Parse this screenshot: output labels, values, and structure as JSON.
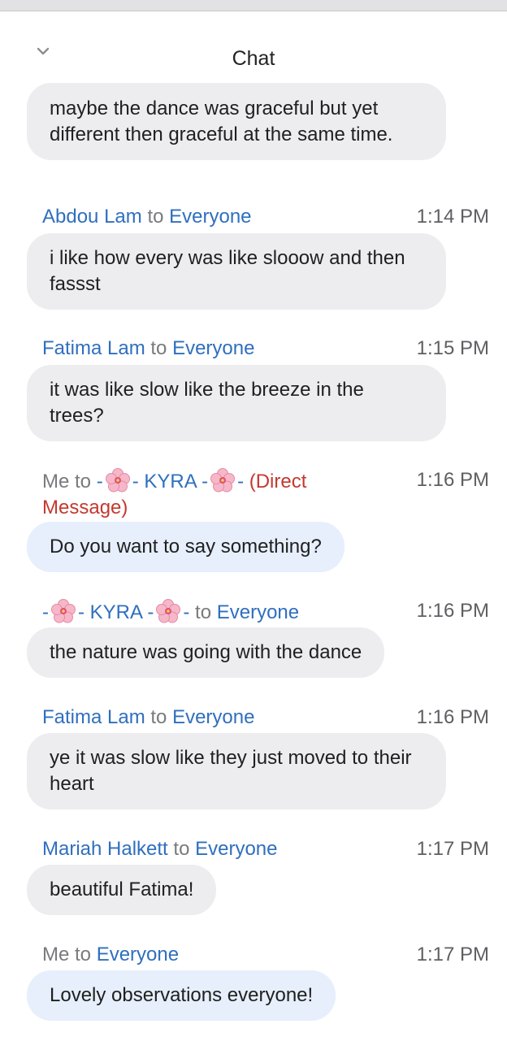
{
  "window": {
    "title": "Chat"
  },
  "header": {
    "collapse_icon": "chevron-down-icon"
  },
  "messages": [
    {
      "sender": "",
      "recipient": "",
      "time": "",
      "text": "maybe the dance was graceful but yet different then graceful at the same time."
    },
    {
      "sender": "Abdou Lam",
      "to_word": "to",
      "recipient": "Everyone",
      "time": "1:14 PM",
      "text": "i like how every was like slooow and then fassst"
    },
    {
      "sender": "Fatima Lam",
      "to_word": "to",
      "recipient": "Everyone",
      "time": "1:15 PM",
      "text": "it was like slow like the breeze in the trees?"
    },
    {
      "sender": "Me",
      "to_word": "to",
      "recipient_prefix": "-",
      "recipient_name": "- KYRA -",
      "recipient_suffix": "-",
      "direct_label": "(Direct Message)",
      "direct_label_line1": "(Direct",
      "direct_label_line2": "Message)",
      "time": "1:16 PM",
      "text": "Do you want to say something?"
    },
    {
      "sender_prefix": "-",
      "sender_name": "- KYRA -",
      "sender_suffix": "-",
      "to_word": "to",
      "recipient": "Everyone",
      "time": "1:16 PM",
      "text": "the nature was going with the dance"
    },
    {
      "sender": "Fatima Lam",
      "to_word": "to",
      "recipient": "Everyone",
      "time": "1:16 PM",
      "text": "ye it was slow like they just moved to their heart"
    },
    {
      "sender": "Mariah Halkett",
      "to_word": "to",
      "recipient": "Everyone",
      "time": "1:17 PM",
      "text": "beautiful Fatima!"
    },
    {
      "sender": "Me",
      "to_word": "to",
      "recipient": "Everyone",
      "time": "1:17 PM",
      "text": "Lovely observations everyone!"
    }
  ],
  "colors": {
    "sender_blue": "#2f6fbe",
    "me_grey": "#7a7a7e",
    "direct_red": "#c4392f",
    "bubble_other": "#ededf0",
    "bubble_mine": "#e6effb"
  },
  "icons": {
    "emoji": "cherry-blossom-icon"
  }
}
